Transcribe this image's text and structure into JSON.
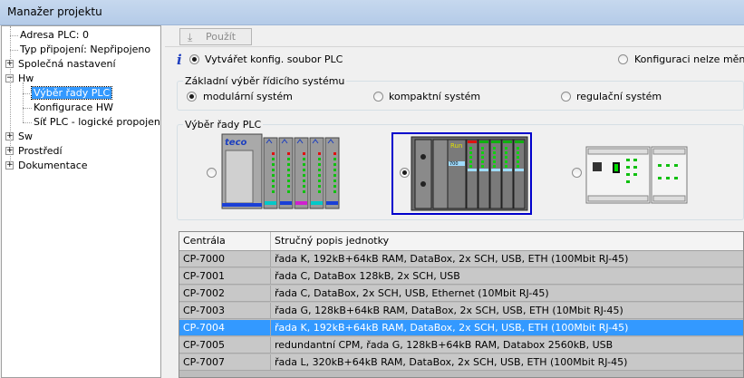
{
  "window": {
    "title": "Manažer projektu"
  },
  "tree": {
    "items": [
      {
        "label": "Adresa PLC: 0",
        "level": 1,
        "expander": ""
      },
      {
        "label": "Typ připojení: Nepřipojeno",
        "level": 1,
        "expander": ""
      },
      {
        "label": "Společná nastavení",
        "level": 0,
        "expander": "+"
      },
      {
        "label": "Hw",
        "level": 0,
        "expander": "-"
      },
      {
        "label": "Výběr řady PLC",
        "level": 2,
        "expander": "",
        "selected": true
      },
      {
        "label": "Konfigurace HW",
        "level": 2,
        "expander": ""
      },
      {
        "label": "Síť PLC - logické propojení",
        "level": 2,
        "expander": ""
      },
      {
        "label": "Sw",
        "level": 0,
        "expander": "+"
      },
      {
        "label": "Prostředí",
        "level": 0,
        "expander": "+"
      },
      {
        "label": "Dokumentace",
        "level": 0,
        "expander": "+"
      }
    ]
  },
  "toolbar": {
    "apply_label": "Použít"
  },
  "options": {
    "create_config_label": "Vytvářet konfig. soubor PLC",
    "create_config_checked": true,
    "locked_label": "Konfiguraci nelze měnit",
    "locked_checked": false
  },
  "basic_selection": {
    "title": "Základní výběr řídicího systému",
    "options": [
      {
        "label": "modulární systém",
        "checked": true
      },
      {
        "label": "kompaktní systém",
        "checked": false
      },
      {
        "label": "regulační systém",
        "checked": false
      }
    ]
  },
  "series_selection": {
    "title": "Výběr řady PLC",
    "options": [
      {
        "name": "modular-plc-image",
        "checked": false,
        "selected": false
      },
      {
        "name": "compact-plc-image",
        "checked": true,
        "selected": true
      },
      {
        "name": "regulation-plc-image",
        "checked": false,
        "selected": false
      }
    ]
  },
  "table": {
    "columns": [
      "Centrála",
      "Stručný popis jednotky"
    ],
    "rows": [
      {
        "cells": [
          "CP-7000",
          "řada K, 192kB+64kB RAM, DataBox, 2x SCH, USB, ETH (100Mbit RJ-45)"
        ],
        "selected": false
      },
      {
        "cells": [
          "CP-7001",
          "řada C, DataBox 128kB, 2x SCH, USB"
        ],
        "selected": false
      },
      {
        "cells": [
          "CP-7002",
          "řada C, DataBox, 2x SCH, USB, Ethernet (10Mbit RJ-45)"
        ],
        "selected": false
      },
      {
        "cells": [
          "CP-7003",
          "řada G, 128kB+64kB RAM, DataBox, 2x SCH, USB, ETH (10Mbit RJ-45)"
        ],
        "selected": false
      },
      {
        "cells": [
          "CP-7004",
          "řada K, 192kB+64kB RAM, DataBox, 2x SCH, USB, ETH (100Mbit RJ-45)"
        ],
        "selected": true
      },
      {
        "cells": [
          "CP-7005",
          "redundantní CPM, řada G, 128kB+64kB RAM, Databox 2560kB, USB"
        ],
        "selected": false
      },
      {
        "cells": [
          "CP-7007",
          "řada L, 320kB+64kB RAM, DataBox, 2x SCH, USB, ETH (100Mbit RJ-45)"
        ],
        "selected": false
      }
    ]
  },
  "plc_images": {
    "modular_logo": "teco",
    "compact_display": "700",
    "compact_run": "Run"
  },
  "colors": {
    "selection": "#3399ff",
    "selected_image_border": "#0000cc",
    "info_icon": "#1f3fbf"
  }
}
